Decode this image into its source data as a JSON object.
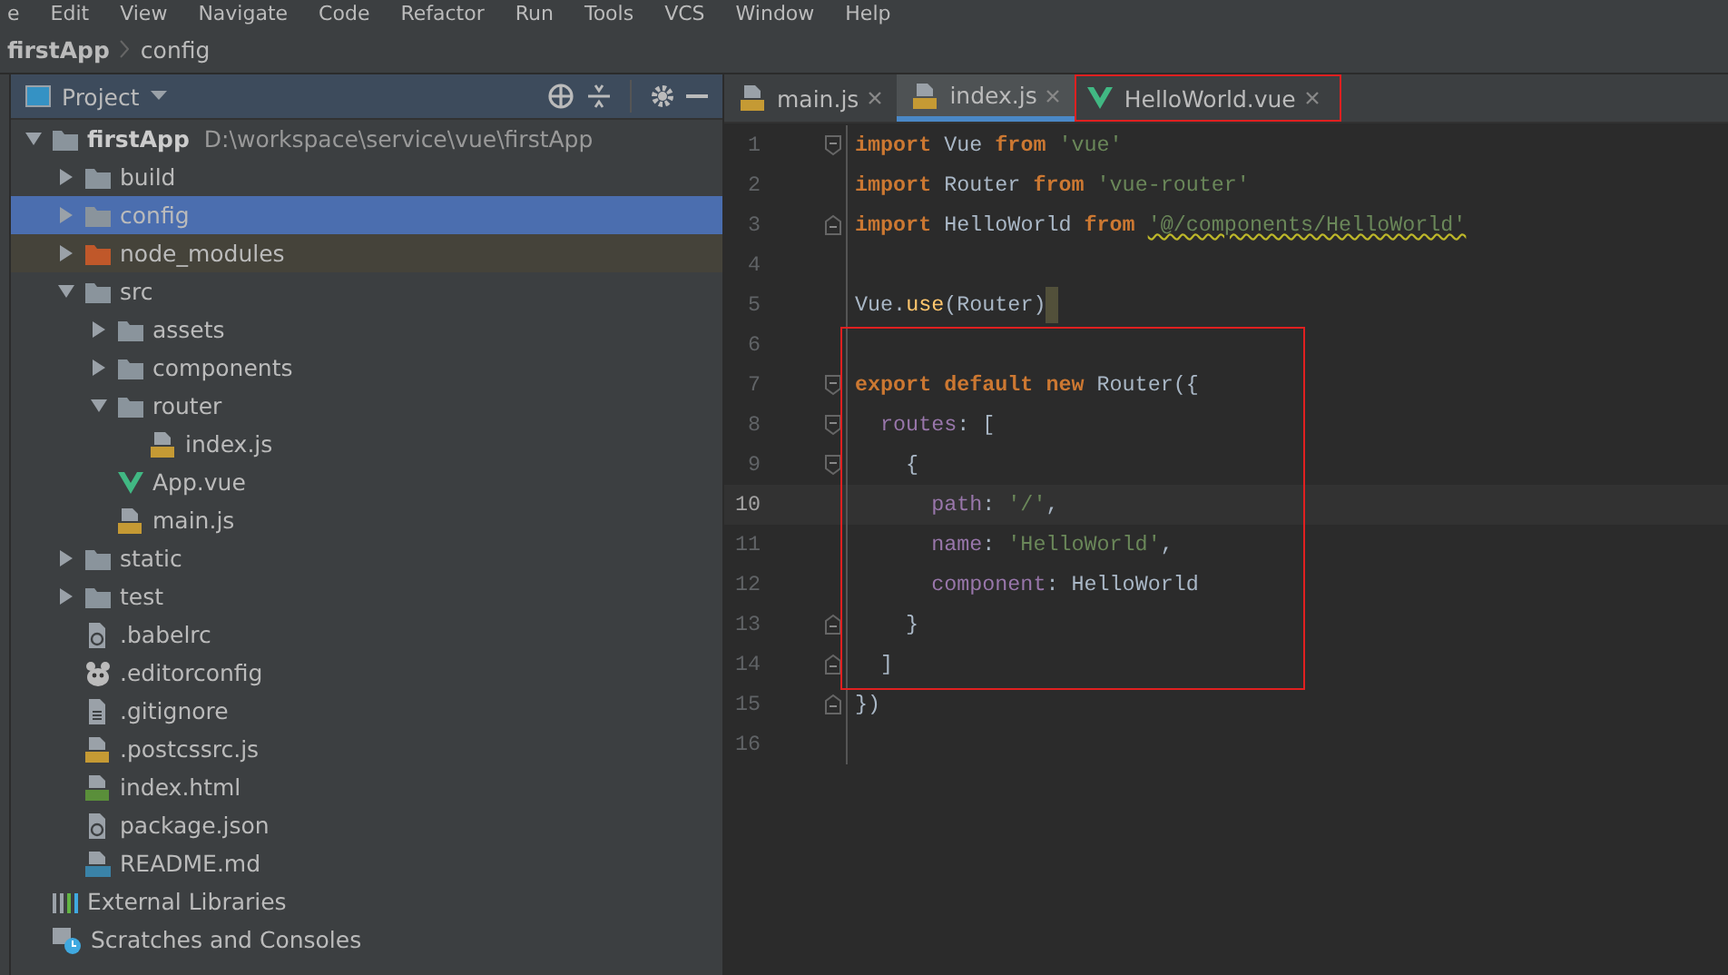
{
  "menu_bar": [
    "e",
    "Edit",
    "View",
    "Navigate",
    "Code",
    "Refactor",
    "Run",
    "Tools",
    "VCS",
    "Window",
    "Help"
  ],
  "breadcrumb": [
    "firstApp",
    "config"
  ],
  "project_panel": {
    "title": "Project",
    "tree": [
      {
        "label": "firstApp",
        "path": "D:\\workspace\\service\\vue\\firstApp",
        "kind": "folder",
        "expanded": true,
        "selected": false,
        "children": [
          {
            "label": "build",
            "kind": "folder",
            "expanded": false,
            "selected": false
          },
          {
            "label": "config",
            "kind": "folder",
            "expanded": false,
            "selected": true
          },
          {
            "label": "node_modules",
            "kind": "excluded-folder",
            "expanded": false,
            "selected": false
          },
          {
            "label": "src",
            "kind": "folder",
            "expanded": true,
            "selected": false,
            "children": [
              {
                "label": "assets",
                "kind": "folder",
                "expanded": false,
                "selected": false
              },
              {
                "label": "components",
                "kind": "folder",
                "expanded": false,
                "selected": false
              },
              {
                "label": "router",
                "kind": "folder",
                "expanded": true,
                "selected": false,
                "children": [
                  {
                    "label": "index.js",
                    "kind": "js",
                    "selected": false
                  }
                ]
              },
              {
                "label": "App.vue",
                "kind": "vue",
                "selected": false
              },
              {
                "label": "main.js",
                "kind": "js",
                "selected": false
              }
            ]
          },
          {
            "label": "static",
            "kind": "folder",
            "expanded": false,
            "selected": false
          },
          {
            "label": "test",
            "kind": "folder",
            "expanded": false,
            "selected": false
          },
          {
            "label": ".babelrc",
            "kind": "config",
            "selected": false
          },
          {
            "label": ".editorconfig",
            "kind": "editorconfig",
            "selected": false
          },
          {
            "label": ".gitignore",
            "kind": "text",
            "selected": false
          },
          {
            "label": ".postcssrc.js",
            "kind": "js",
            "selected": false
          },
          {
            "label": "index.html",
            "kind": "html",
            "selected": false
          },
          {
            "label": "package.json",
            "kind": "config",
            "selected": false
          },
          {
            "label": "README.md",
            "kind": "md",
            "selected": false
          }
        ]
      },
      {
        "label": "External Libraries",
        "kind": "libraries",
        "selected": false
      },
      {
        "label": "Scratches and Consoles",
        "kind": "scratches",
        "selected": false
      }
    ]
  },
  "editor_tabs": [
    {
      "label": "main.js",
      "kind": "js",
      "selected": false,
      "outlined": false
    },
    {
      "label": "index.js",
      "kind": "js",
      "selected": true,
      "outlined": false
    },
    {
      "label": "HelloWorld.vue",
      "kind": "vue",
      "selected": false,
      "outlined": true
    }
  ],
  "code_lines": [
    {
      "number": "1",
      "fold_start": true,
      "fold_end": false,
      "current": false,
      "caret": false,
      "outlined": false,
      "tokens": [
        {
          "kind": "keyword",
          "text": "import"
        },
        {
          "kind": "plain",
          "text": " Vue "
        },
        {
          "kind": "keyword",
          "text": "from "
        },
        {
          "kind": "string",
          "text": "'vue'"
        }
      ]
    },
    {
      "number": "2",
      "fold_start": false,
      "fold_end": false,
      "current": false,
      "caret": false,
      "outlined": false,
      "tokens": [
        {
          "kind": "keyword",
          "text": "import"
        },
        {
          "kind": "plain",
          "text": " Router "
        },
        {
          "kind": "keyword",
          "text": "from "
        },
        {
          "kind": "string",
          "text": "'vue-router'"
        }
      ]
    },
    {
      "number": "3",
      "fold_start": false,
      "fold_end": true,
      "current": false,
      "caret": false,
      "outlined": false,
      "tokens": [
        {
          "kind": "keyword",
          "text": "import"
        },
        {
          "kind": "plain",
          "text": " HelloWorld "
        },
        {
          "kind": "keyword",
          "text": "from "
        },
        {
          "kind": "warning-string",
          "text": "'@/components/HelloWorld'"
        }
      ]
    },
    {
      "number": "4",
      "fold_start": false,
      "fold_end": false,
      "current": false,
      "caret": false,
      "outlined": false
    },
    {
      "number": "5",
      "fold_start": false,
      "fold_end": false,
      "current": false,
      "caret": true,
      "outlined": false,
      "tokens": [
        {
          "kind": "plain",
          "text": "Vue."
        },
        {
          "kind": "method",
          "text": "use"
        },
        {
          "kind": "plain",
          "text": "(Router)"
        }
      ]
    },
    {
      "number": "6",
      "fold_start": false,
      "fold_end": false,
      "current": false,
      "caret": false,
      "outlined": false
    },
    {
      "number": "7",
      "fold_start": true,
      "fold_end": false,
      "current": false,
      "caret": false,
      "outlined": true,
      "tokens": [
        {
          "kind": "keyword",
          "text": "export default new"
        },
        {
          "kind": "plain",
          "text": " Router({"
        }
      ]
    },
    {
      "number": "8",
      "fold_start": true,
      "fold_end": false,
      "current": false,
      "caret": false,
      "outlined": true,
      "tokens": [
        {
          "kind": "property",
          "text": "  routes"
        },
        {
          "kind": "plain",
          "text": ": ["
        }
      ]
    },
    {
      "number": "9",
      "fold_start": true,
      "fold_end": false,
      "current": false,
      "caret": false,
      "outlined": true,
      "tokens": [
        {
          "kind": "plain",
          "text": "    {"
        }
      ]
    },
    {
      "number": "10",
      "fold_start": false,
      "fold_end": false,
      "current": true,
      "caret": false,
      "outlined": true,
      "tokens": [
        {
          "kind": "property",
          "text": "      path"
        },
        {
          "kind": "plain",
          "text": ": "
        },
        {
          "kind": "string",
          "text": "'/'"
        },
        {
          "kind": "plain",
          "text": ","
        }
      ]
    },
    {
      "number": "11",
      "fold_start": false,
      "fold_end": false,
      "current": false,
      "caret": false,
      "outlined": true,
      "tokens": [
        {
          "kind": "property",
          "text": "      name"
        },
        {
          "kind": "plain",
          "text": ": "
        },
        {
          "kind": "string",
          "text": "'HelloWorld'"
        },
        {
          "kind": "plain",
          "text": ","
        }
      ]
    },
    {
      "number": "12",
      "fold_start": false,
      "fold_end": false,
      "current": false,
      "caret": false,
      "outlined": true,
      "tokens": [
        {
          "kind": "property",
          "text": "      component"
        },
        {
          "kind": "plain",
          "text": ": HelloWorld"
        }
      ]
    },
    {
      "number": "13",
      "fold_start": false,
      "fold_end": true,
      "current": false,
      "caret": false,
      "outlined": true,
      "tokens": [
        {
          "kind": "plain",
          "text": "    }"
        }
      ]
    },
    {
      "number": "14",
      "fold_start": false,
      "fold_end": true,
      "current": false,
      "caret": false,
      "outlined": true,
      "tokens": [
        {
          "kind": "plain",
          "text": "  ]"
        }
      ]
    },
    {
      "number": "15",
      "fold_start": false,
      "fold_end": true,
      "current": false,
      "caret": false,
      "outlined": false,
      "tokens": [
        {
          "kind": "plain",
          "text": "})"
        }
      ]
    },
    {
      "number": "16",
      "fold_start": false,
      "fold_end": false,
      "current": false,
      "caret": false,
      "outlined": false
    }
  ]
}
